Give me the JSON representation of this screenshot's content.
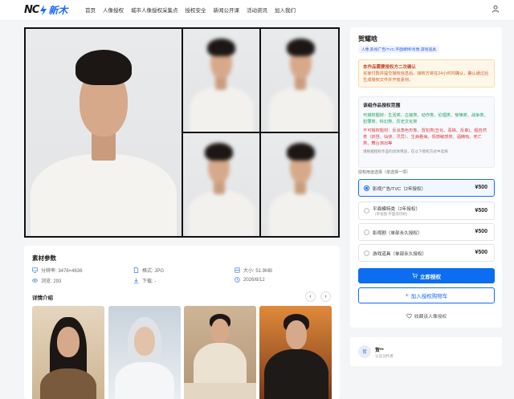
{
  "header": {
    "logo_left": "NC",
    "logo_right": "新木",
    "nav": [
      "首页",
      "人像授权",
      "城市人像授权采集点",
      "授权安全",
      "新闻公开课",
      "活动资讯",
      "加入我们"
    ]
  },
  "product": {
    "title": "贺耀晗",
    "tags": "人像,影视广告/TVC,平面模特/肖像,游戏道具",
    "notice_title": "本作品需要授权方二次确认",
    "notice_desc": "买家付款并提交授权信息后，授权方将在24小时内确认，确认通过后生成授权文件并开放素材。"
  },
  "scope": {
    "title": "该组作品授权范围",
    "allowed": "可授权题材：生活类、古装类、动作类、伦理类、惊悚类、战争类、犯罪类、科幻类、历史文化类",
    "forbidden": "不可授权题材：反派角色形象、冒犯类(丑化、恶搞、反串)、超自然类（妖怪、仙侠、灵异）、生病看病、情感敏感类、酒精吸、死亡类、舞台演出等",
    "note": "请根据授权作品的具体用途，在以下授权方式中选择"
  },
  "license": {
    "choose_label": "授权用途选择（单选择一项）",
    "options": [
      {
        "label": "影视广告/TVC（2年授权）",
        "sub": "",
        "price": "¥500",
        "selected": true
      },
      {
        "label": "平面模特类（2年授权）",
        "sub": "(单张图 平面或印刷)",
        "price": "¥500",
        "selected": false
      },
      {
        "label": "影视剧（单部永久授权）",
        "sub": "",
        "price": "¥500",
        "selected": false
      },
      {
        "label": "游戏道具（单部永久授权）",
        "sub": "",
        "price": "¥500",
        "selected": false
      }
    ],
    "buy_label": "立即授权",
    "cart_label": "加入授权购物车",
    "fav_label": "收藏该人像授权"
  },
  "author": {
    "avatar_text": "贺",
    "name": "贺**",
    "badge": "认证创作者"
  },
  "material": {
    "title": "素材参数",
    "resolution": "分辨率: 3476×4636",
    "format": "格式: JPG",
    "size": "大小: 51.9MB",
    "views": "浏览: 293",
    "downloads": "下载: -",
    "date": "2026/8/12",
    "detail_title": "详情介绍"
  },
  "colors": {
    "accent": "#0c6df0",
    "notice_text": "#d9531e",
    "allowed_text": "#19a15b",
    "forbidden_text": "#e0393b"
  }
}
